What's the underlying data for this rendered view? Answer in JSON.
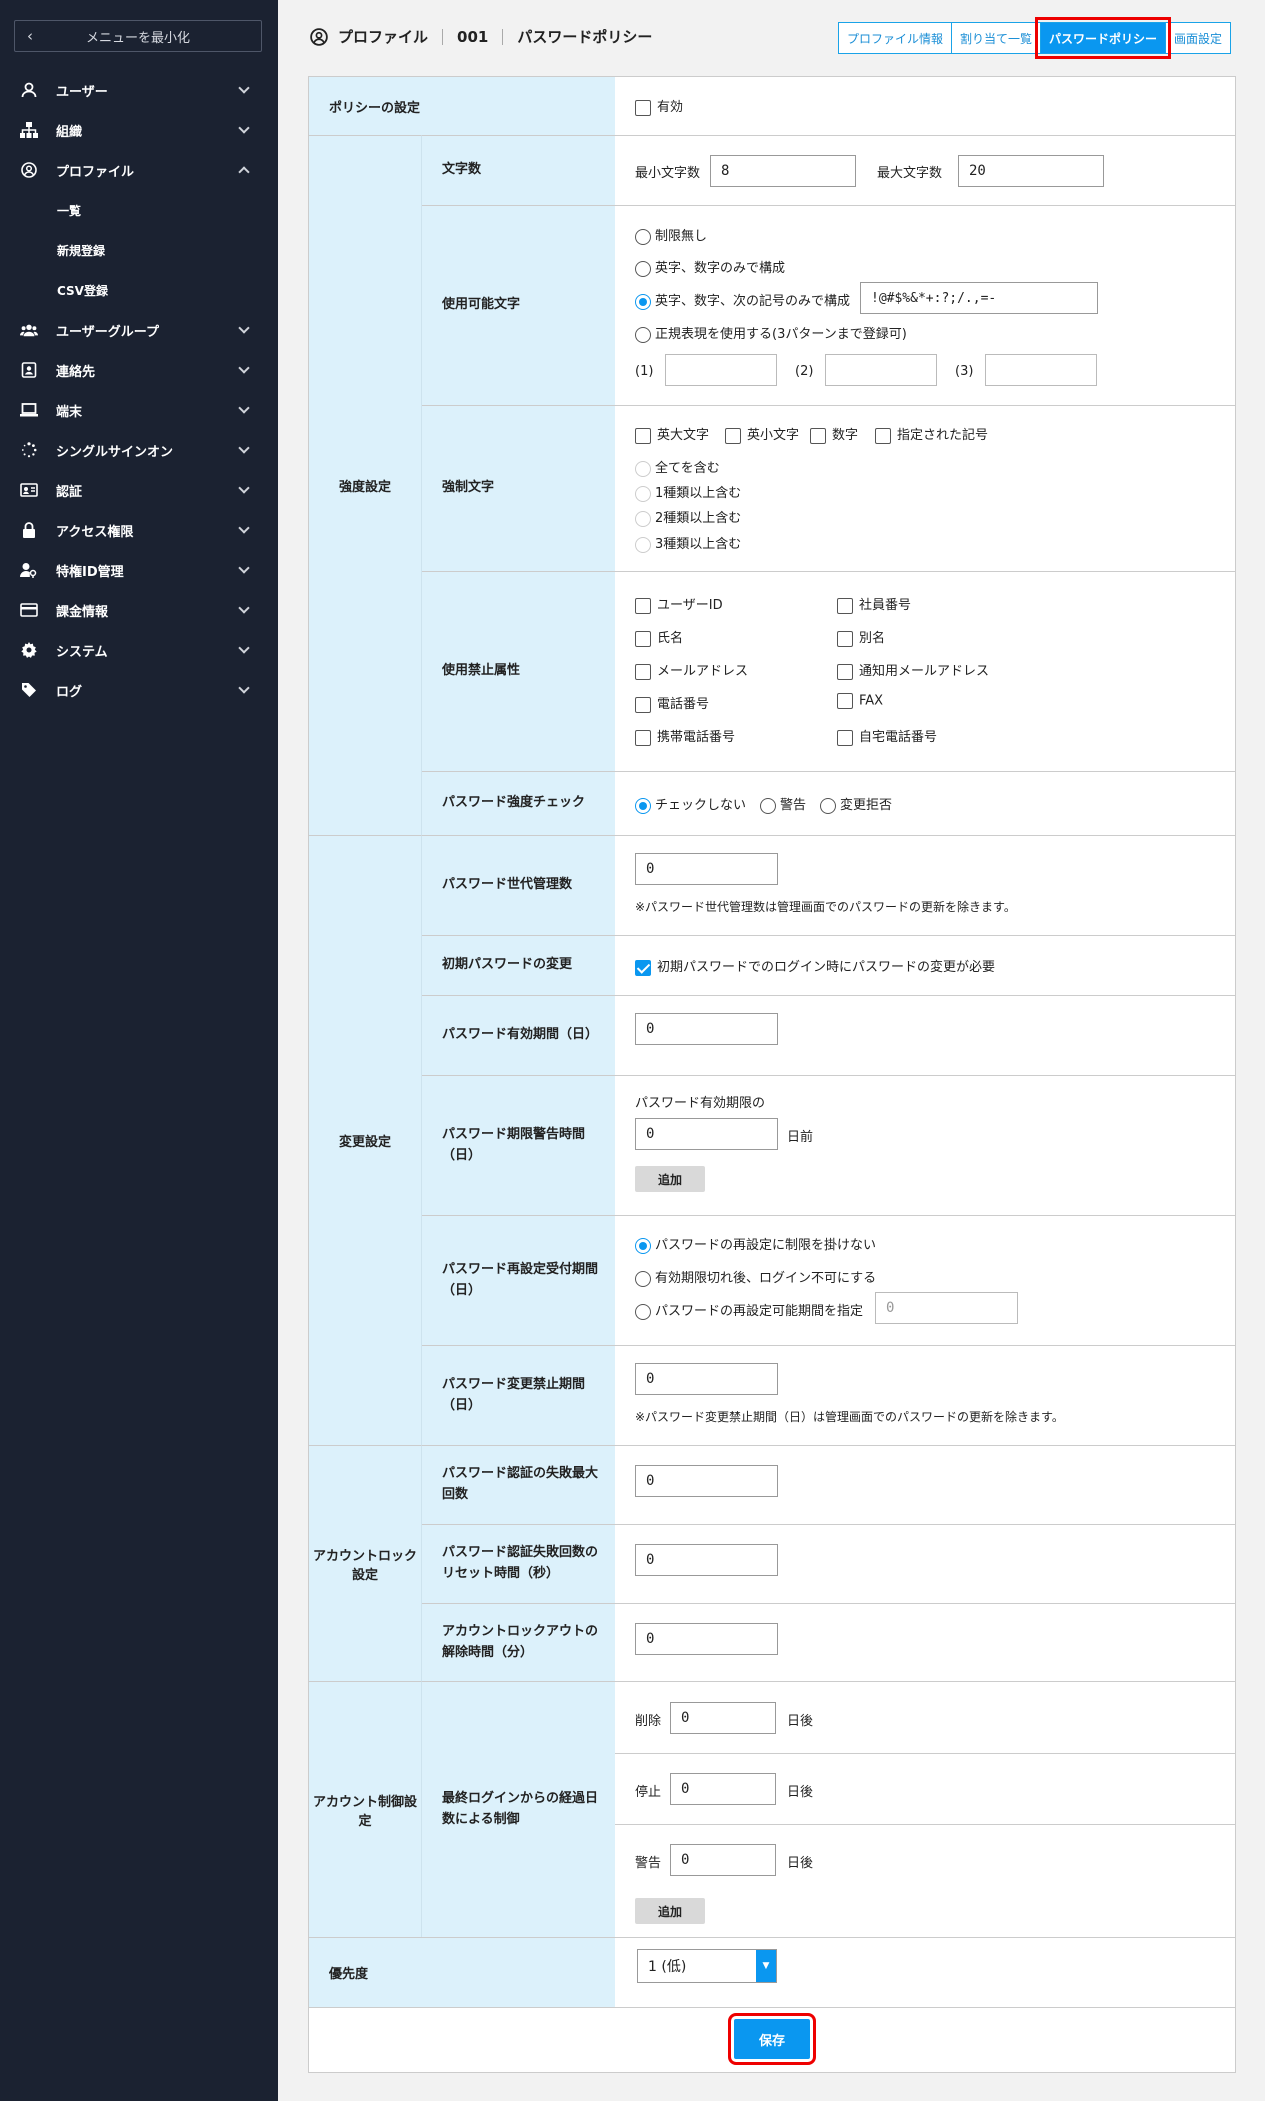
{
  "sidebar": {
    "collapse_label": "メニューを最小化",
    "items": [
      {
        "label": "ユーザー"
      },
      {
        "label": "組織"
      },
      {
        "label": "プロファイル"
      },
      {
        "label": "ユーザーグループ"
      },
      {
        "label": "連絡先"
      },
      {
        "label": "端末"
      },
      {
        "label": "シングルサインオン"
      },
      {
        "label": "認証"
      },
      {
        "label": "アクセス権限"
      },
      {
        "label": "特権ID管理"
      },
      {
        "label": "課金情報"
      },
      {
        "label": "システム"
      },
      {
        "label": "ログ"
      }
    ],
    "sub_items": [
      {
        "label": "一覧"
      },
      {
        "label": "新規登録"
      },
      {
        "label": "CSV登録"
      }
    ]
  },
  "header": {
    "breadcrumb": [
      "プロファイル",
      "001",
      "パスワードポリシー"
    ],
    "tabs": [
      "プロファイル情報",
      "割り当て一覧",
      "パスワードポリシー",
      "画面設定"
    ]
  },
  "form": {
    "policy_setting": "ポリシーの設定",
    "enabled": "有効",
    "strength": "強度設定",
    "char_count": "文字数",
    "min_label": "最小文字数",
    "min_value": "8",
    "max_label": "最大文字数",
    "max_value": "20",
    "allowed_chars": "使用可能文字",
    "allowed_opts": [
      "制限無し",
      "英字、数字のみで構成",
      "英字、数字、次の記号のみで構成",
      "正規表現を使用する(3パターンまで登録可)"
    ],
    "symbols": "!@#$%&*+:?;/.,=-",
    "regex_labels": [
      "(1)",
      "(2)",
      "(3)"
    ],
    "required_chars": "強制文字",
    "required_types": [
      "英大文字",
      "英小文字",
      "数字",
      "指定された記号"
    ],
    "required_opts": [
      "全てを含む",
      "1種類以上含む",
      "2種類以上含む",
      "3種類以上含む"
    ],
    "forbidden": "使用禁止属性",
    "forbidden_left": [
      "ユーザーID",
      "氏名",
      "メールアドレス",
      "電話番号",
      "携帯電話番号"
    ],
    "forbidden_right": [
      "社員番号",
      "別名",
      "通知用メールアドレス",
      "FAX",
      "自宅電話番号"
    ],
    "strength_check": "パスワード強度チェック",
    "strength_opts": [
      "チェックしない",
      "警告",
      "変更拒否"
    ],
    "change": "変更設定",
    "history": "パスワード世代管理数",
    "history_value": "0",
    "history_note": "※パスワード世代管理数は管理画面でのパスワードの更新を除きます。",
    "initial_change": "初期パスワードの変更",
    "initial_change_cb": "初期パスワードでのログイン時にパスワードの変更が必要",
    "expiry": "パスワード有効期間（日）",
    "expiry_value": "0",
    "warn_time": "パスワード期限警告時間（日）",
    "warn_prefix": "パスワード有効期限の",
    "warn_value": "0",
    "warn_suffix": "日前",
    "add": "追加",
    "reset_period": "パスワード再設定受付期間（日）",
    "reset_opts": [
      "パスワードの再設定に制限を掛けない",
      "有効期限切れ後、ログイン不可にする",
      "パスワードの再設定可能期間を指定"
    ],
    "reset_value": "0",
    "change_prohibit": "パスワード変更禁止期間（日）",
    "change_prohibit_value": "0",
    "change_prohibit_note": "※パスワード変更禁止期間（日）は管理画面でのパスワードの更新を除きます。",
    "lock": "アカウントロック設定",
    "fail_max": "パスワード認証の失敗最大回数",
    "fail_max_value": "0",
    "fail_reset": "パスワード認証失敗回数のリセット時間（秒）",
    "fail_reset_value": "0",
    "unlock": "アカウントロックアウトの解除時間（分）",
    "unlock_value": "0",
    "control": "アカウント制御設定",
    "last_login": "最終ログインからの経過日数による制御",
    "ctrl_delete": "削除",
    "ctrl_stop": "停止",
    "ctrl_warn": "警告",
    "ctrl_value": "0",
    "ctrl_suffix": "日後",
    "priority": "優先度",
    "priority_value": "1 (低)",
    "save": "保存"
  }
}
